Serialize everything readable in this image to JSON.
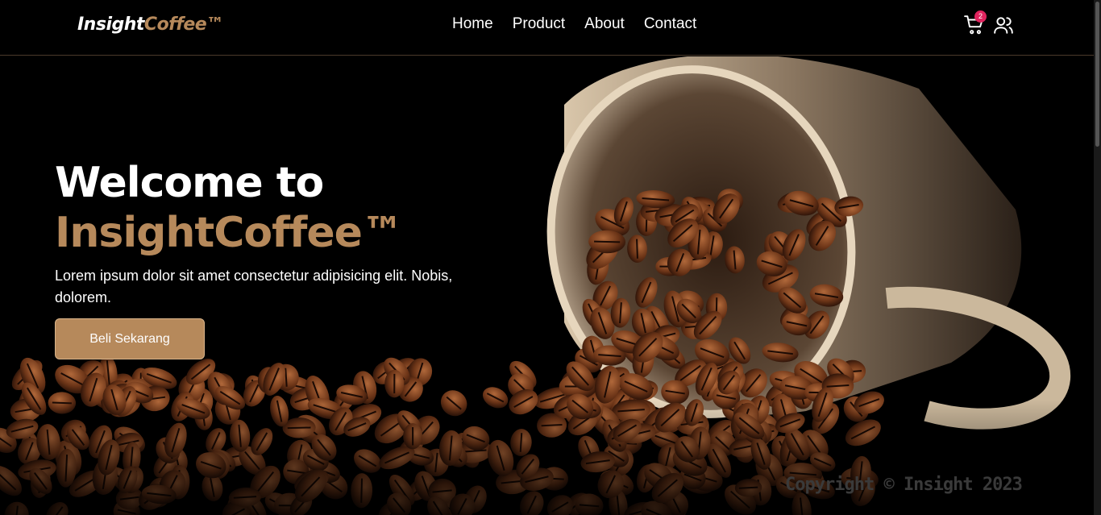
{
  "brand": {
    "name_main": "Insight",
    "name_accent": "Coffee™"
  },
  "nav": {
    "links": [
      "Home",
      "Product",
      "About",
      "Contact"
    ],
    "cart_count": "2",
    "cart_icon": "cart-icon",
    "user_icon": "users-icon"
  },
  "hero": {
    "title_line1": "Welcome to",
    "title_line2": "InsightCoffee™",
    "description": "Lorem ipsum dolor sit amet consectetur adipisicing elit. Nobis, dolorem.",
    "cta_label": "Beli Sekarang"
  },
  "footer": {
    "copyright": "Copyright © Insight 2023"
  },
  "colors": {
    "accent": "#b6895b",
    "badge": "#e0245e",
    "background": "#000000"
  }
}
